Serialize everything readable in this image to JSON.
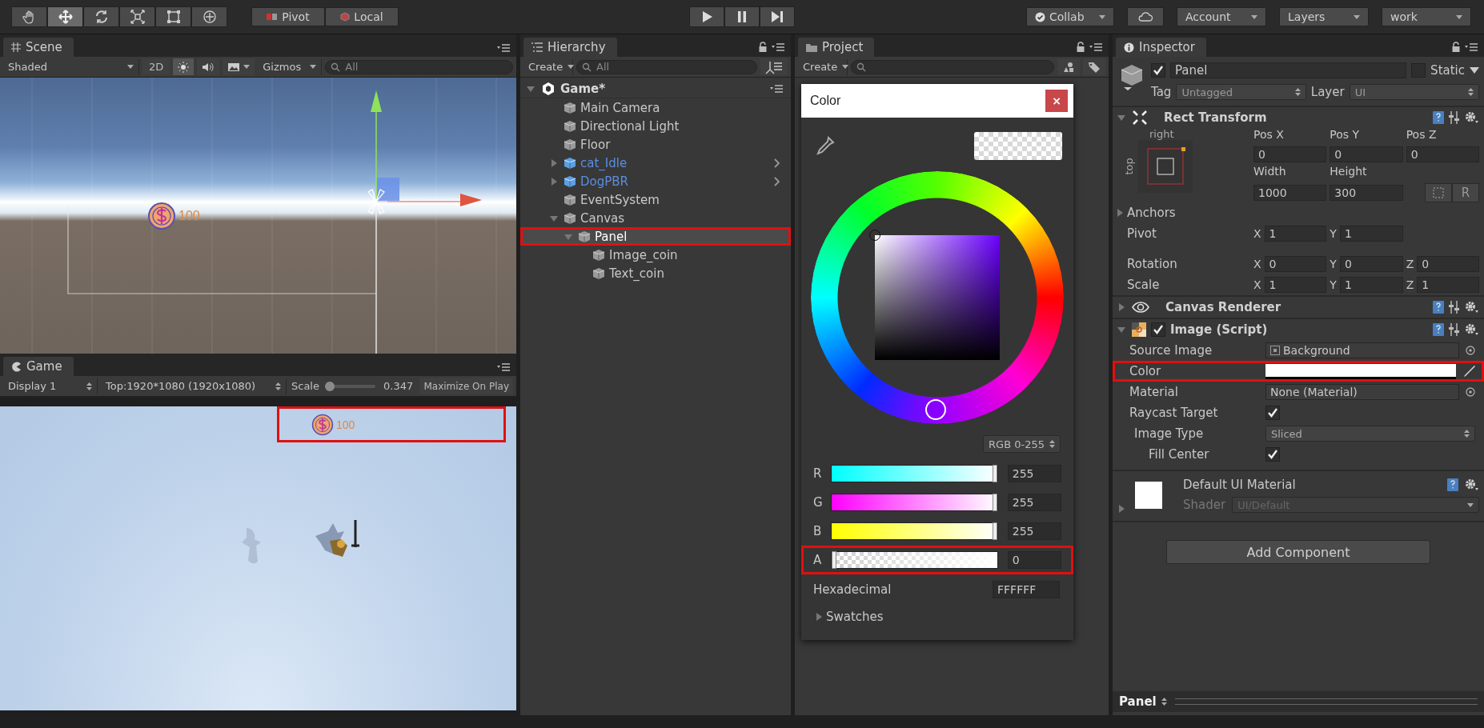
{
  "toolbar": {
    "tools": [
      {
        "kind": "hand",
        "selected": false
      },
      {
        "kind": "move",
        "selected": true
      },
      {
        "kind": "rotate",
        "selected": false
      },
      {
        "kind": "scale",
        "selected": false
      },
      {
        "kind": "rect",
        "selected": false
      },
      {
        "kind": "transform",
        "selected": false
      }
    ],
    "pivot": "Pivot",
    "local": "Local",
    "playback": [
      {
        "kind": "play"
      },
      {
        "kind": "pause"
      },
      {
        "kind": "step"
      }
    ],
    "collab": "Collab",
    "account": "Account",
    "layers": "Layers",
    "layout": "work"
  },
  "scene": {
    "tab": "Scene",
    "shading": "Shaded",
    "mode_2d_label": "2D",
    "mode_2d": false,
    "lighting": true,
    "gizmos": "Gizmos",
    "search_placeholder": "All",
    "score": "100"
  },
  "game": {
    "tab": "Game",
    "display": "Display 1",
    "resolution": "Top:1920*1080 (1920x1080)",
    "scale_label": "Scale",
    "scale_slider": {
      "level": 0.05
    },
    "scale_value": "0.347",
    "maximize": "Maximize On Play",
    "score": "100",
    "score_annotated": true
  },
  "hierarchy": {
    "tab": "Hierarchy",
    "create": "Create",
    "search_placeholder": "All",
    "scene_name": "Game*",
    "items": [
      {
        "name": "Main Camera",
        "kind": "object",
        "selected": false,
        "annotated": false
      },
      {
        "name": "Directional Light",
        "kind": "object",
        "selected": false,
        "annotated": false
      },
      {
        "name": "Floor",
        "kind": "object",
        "selected": false,
        "annotated": false
      },
      {
        "name": "cat_Idle",
        "kind": "prefab",
        "expanded": false,
        "selected": false,
        "annotated": false
      },
      {
        "name": "DogPBR",
        "kind": "prefab",
        "expanded": false,
        "selected": false,
        "annotated": false
      },
      {
        "name": "EventSystem",
        "kind": "object",
        "selected": false,
        "annotated": false
      },
      {
        "name": "Canvas",
        "kind": "object",
        "expanded": true,
        "selected": false,
        "annotated": false,
        "children": [
          {
            "name": "Panel",
            "kind": "object",
            "expanded": true,
            "selected": true,
            "annotated": true,
            "children": [
              {
                "name": "Image_coin",
                "kind": "object",
                "selected": false,
                "annotated": false
              },
              {
                "name": "Text_coin",
                "kind": "object",
                "selected": false,
                "annotated": false
              }
            ]
          }
        ]
      }
    ]
  },
  "project": {
    "tab": "Project",
    "create": "Create"
  },
  "color_picker": {
    "title": "Color",
    "close": "×",
    "mode": "RGB 0-255",
    "channels": [
      {
        "label": "R",
        "kind": "red",
        "level": 1,
        "value": "255",
        "annotated": false
      },
      {
        "label": "G",
        "kind": "green",
        "level": 1,
        "value": "255",
        "annotated": false
      },
      {
        "label": "B",
        "kind": "blue",
        "level": 1,
        "value": "255",
        "annotated": false
      },
      {
        "label": "A",
        "kind": "alpha",
        "level": 0,
        "value": "0",
        "annotated": true
      }
    ],
    "hex_label": "Hexadecimal",
    "hex": "FFFFFF",
    "swatches": "Swatches"
  },
  "inspector": {
    "tab": "Inspector",
    "object": {
      "active": true,
      "name": "Panel",
      "static_label": "Static",
      "static": false,
      "tag_label": "Tag",
      "tag": "Untagged",
      "layer_label": "Layer",
      "layer": "UI"
    },
    "rect_transform": {
      "title": "Rect Transform",
      "anchor_h": "right",
      "anchor_v": "top",
      "position": [
        {
          "label": "Pos X",
          "value": "0"
        },
        {
          "label": "Pos Y",
          "value": "0"
        },
        {
          "label": "Pos Z",
          "value": "0"
        }
      ],
      "size": [
        {
          "label": "Width",
          "value": "1000"
        },
        {
          "label": "Height",
          "value": "300"
        }
      ],
      "raw_button": "R",
      "anchors": "Anchors",
      "vectors": [
        {
          "label": "Pivot",
          "fields": [
            {
              "axis": "X",
              "value": "1"
            },
            {
              "axis": "Y",
              "value": "1"
            }
          ]
        },
        {
          "label": "Rotation",
          "fields": [
            {
              "axis": "X",
              "value": "0"
            },
            {
              "axis": "Y",
              "value": "0"
            },
            {
              "axis": "Z",
              "value": "0"
            }
          ]
        },
        {
          "label": "Scale",
          "fields": [
            {
              "axis": "X",
              "value": "1"
            },
            {
              "axis": "Y",
              "value": "1"
            },
            {
              "axis": "Z",
              "value": "1"
            }
          ]
        }
      ]
    },
    "canvas_renderer": {
      "title": "Canvas Renderer"
    },
    "image": {
      "title": "Image (Script)",
      "enabled": true,
      "source_image_label": "Source Image",
      "source_image": "Background",
      "color_label": "Color",
      "color": "#ffffff",
      "color_annotated": true,
      "material_label": "Material",
      "material": "None (Material)",
      "raycast_label": "Raycast Target",
      "raycast": true,
      "image_type_label": "Image Type",
      "image_type": "Sliced",
      "fill_center_label": "Fill Center",
      "fill_center": true
    },
    "material": {
      "name": "Default UI Material",
      "shader_label": "Shader",
      "shader": "UI/Default"
    },
    "add_component": "Add Component",
    "footer": "Panel"
  }
}
